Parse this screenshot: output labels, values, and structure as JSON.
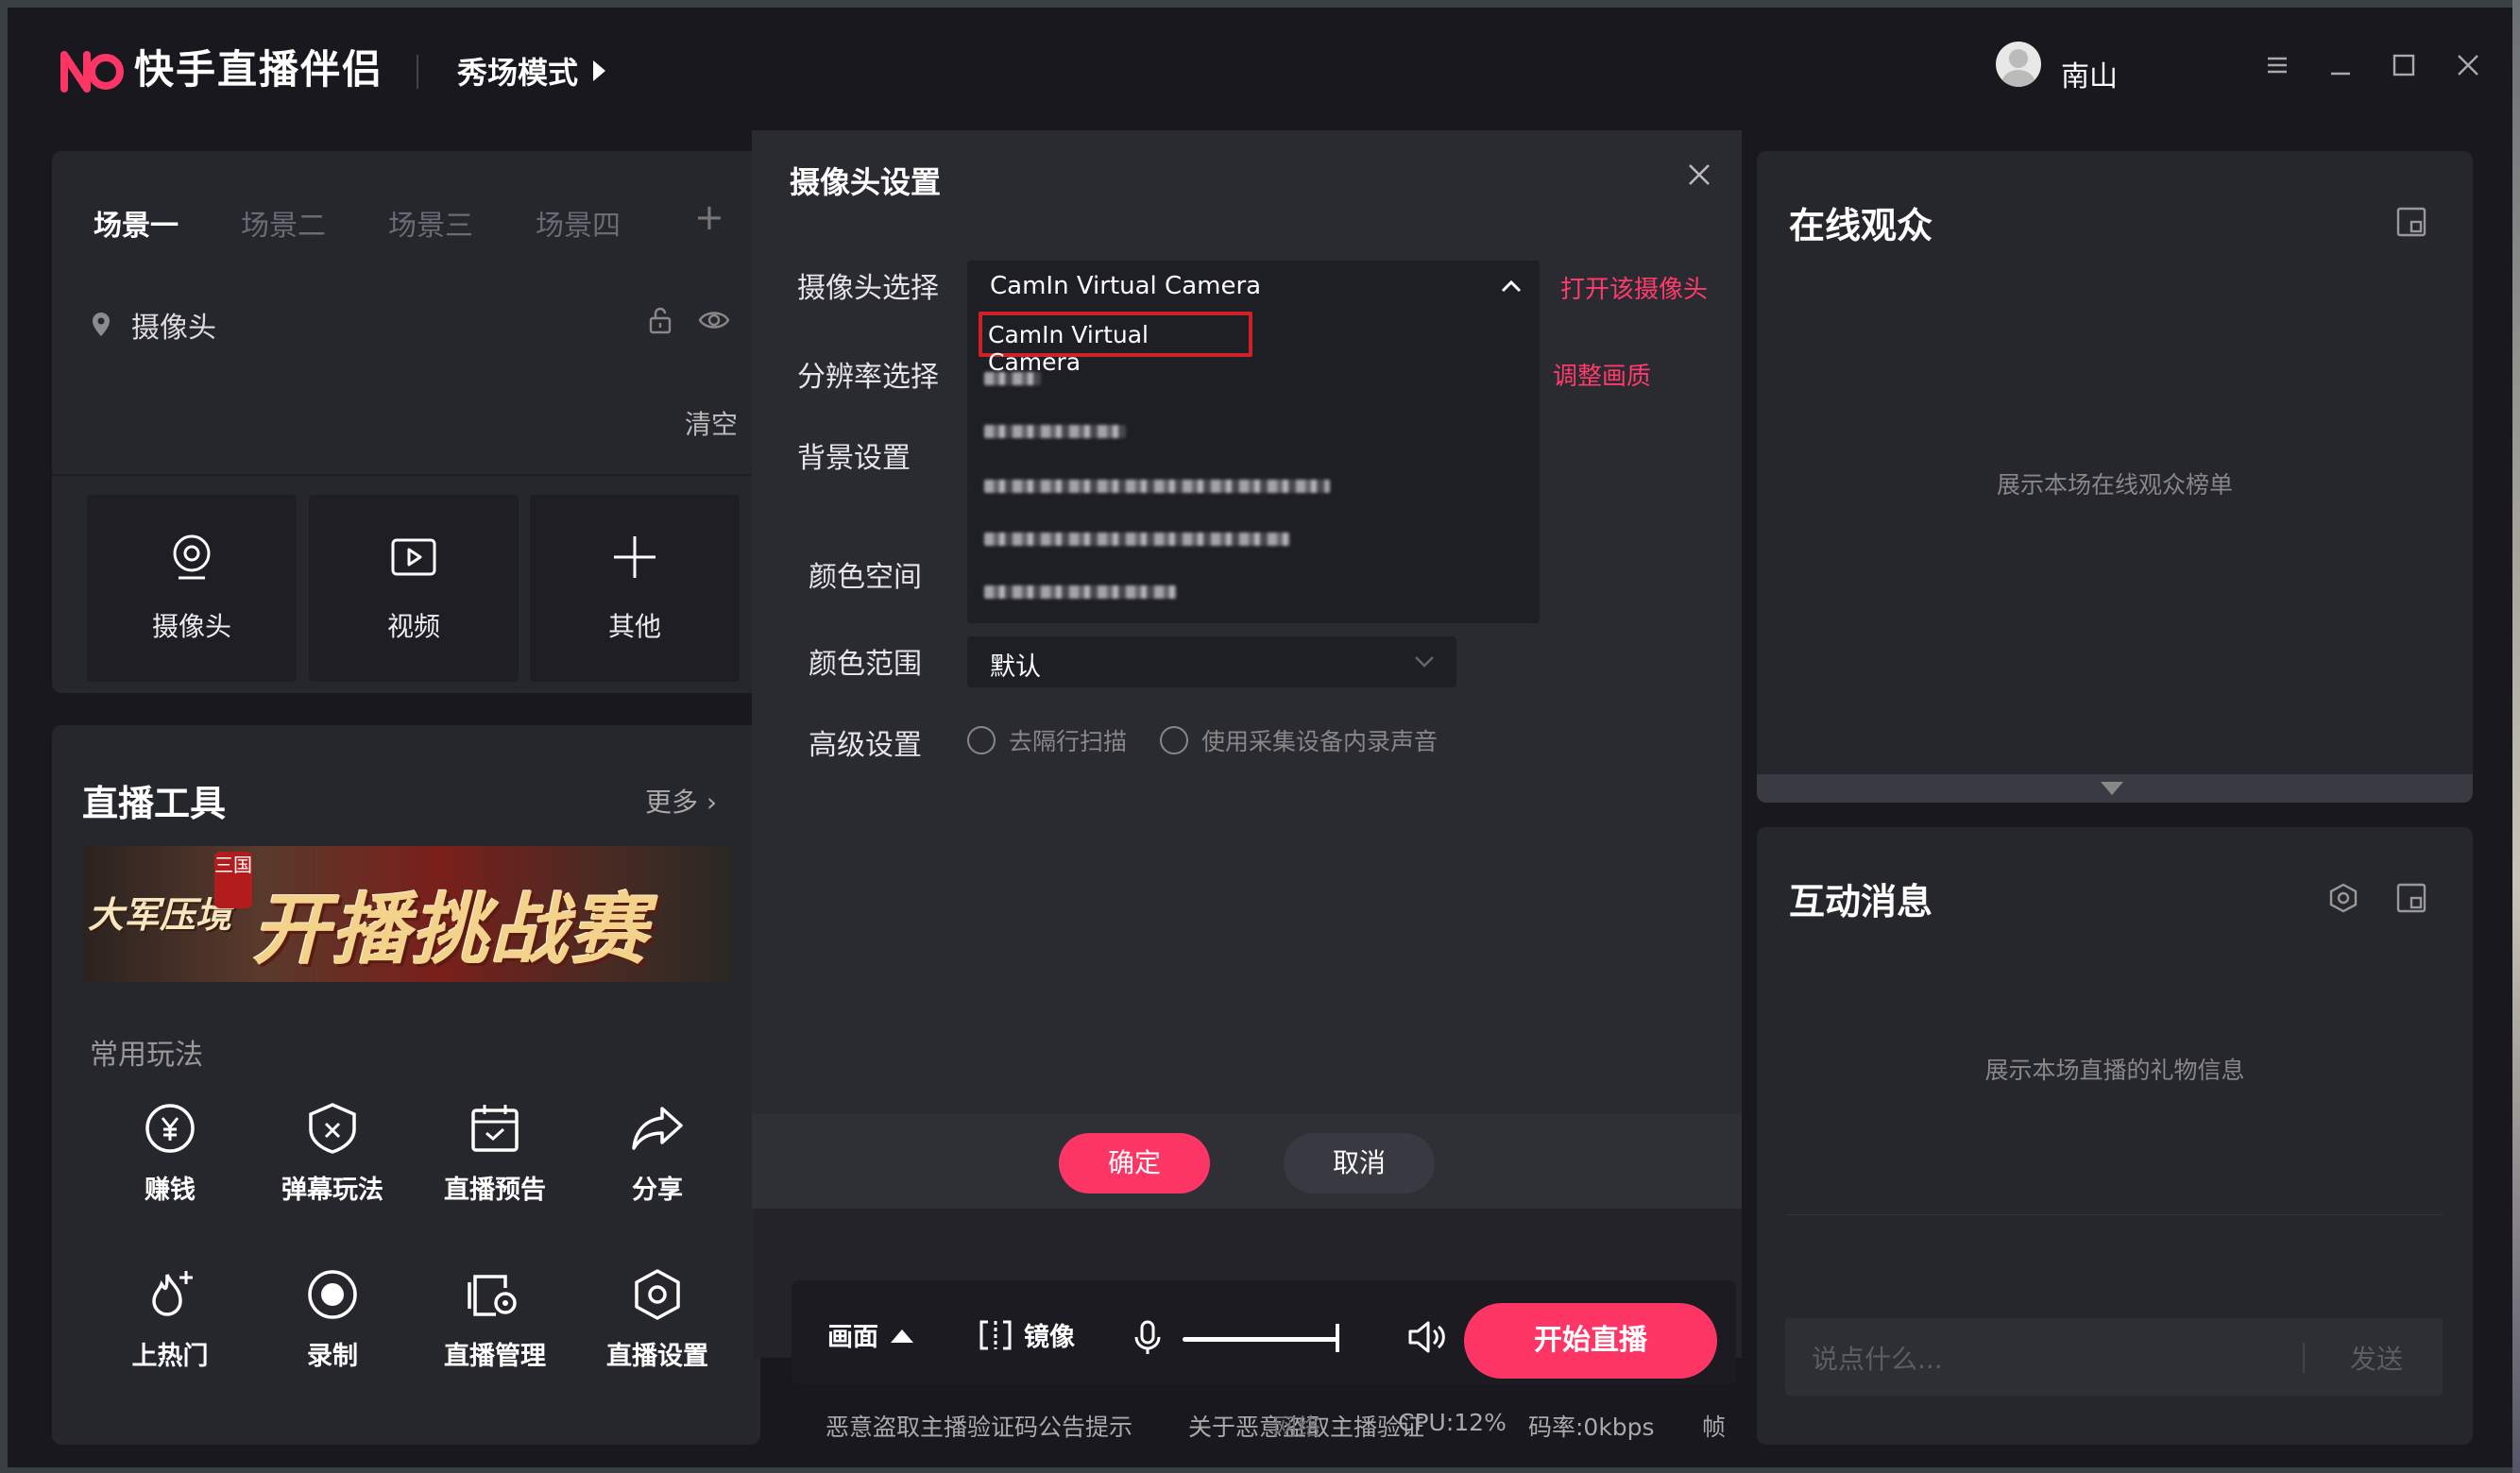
{
  "app": {
    "name": "快手直播伴侣",
    "mode": "秀场模式",
    "user": "南山",
    "brand_color": "#fe3666"
  },
  "scenes": {
    "tabs": [
      "场景一",
      "场景二",
      "场景三",
      "场景四"
    ],
    "active_index": 0,
    "add_label": "+",
    "source_item": "摄像头",
    "clear_label": "清空",
    "add_sources": [
      {
        "label": "摄像头",
        "icon": "webcam-icon"
      },
      {
        "label": "视频",
        "icon": "video-icon"
      },
      {
        "label": "其他",
        "icon": "plus-icon"
      }
    ]
  },
  "tools": {
    "title": "直播工具",
    "more_label": "更多",
    "banner": {
      "prefix": "大军压境",
      "seal": "三国",
      "main": "开播挑战赛"
    },
    "common_title": "常用玩法",
    "items": [
      {
        "label": "赚钱",
        "icon": "yen-coin-icon"
      },
      {
        "label": "弹幕玩法",
        "icon": "shield-game-icon"
      },
      {
        "label": "直播预告",
        "icon": "calendar-icon"
      },
      {
        "label": "分享",
        "icon": "share-arrow-icon"
      },
      {
        "label": "上热门",
        "icon": "flame-plus-icon"
      },
      {
        "label": "录制",
        "icon": "record-icon"
      },
      {
        "label": "直播管理",
        "icon": "manage-icon"
      },
      {
        "label": "直播设置",
        "icon": "settings-hex-icon"
      }
    ]
  },
  "dialog": {
    "title": "摄像头设置",
    "labels": {
      "camera": "摄像头选择",
      "resolution": "分辨率选择",
      "background": "背景设置",
      "color_space": "颜色空间",
      "color_range": "颜色范围",
      "advanced": "高级设置"
    },
    "camera_value": "CamIn Virtual Camera",
    "camera_options": [
      "CamIn Virtual Camera"
    ],
    "open_camera_link": "打开该摄像头",
    "adjust_quality_link": "调整画质",
    "color_range_value": "默认",
    "options": [
      "去隔行扫描",
      "使用采集设备内录声音"
    ],
    "ok_label": "确定",
    "cancel_label": "取消"
  },
  "bottom": {
    "canvas_label": "画面",
    "mirror_label": "镜像",
    "volume": 1.0,
    "start_label": "开始直播",
    "notices": [
      "恶意盗取主播验证码公告提示",
      "关于恶意盗取主播验证"
    ],
    "overlap_text": "网络",
    "cpu": "CPU:12%",
    "bitrate": "码率:0kbps",
    "fps_label": "帧"
  },
  "audience": {
    "title": "在线观众",
    "placeholder": "展示本场在线观众榜单"
  },
  "messages": {
    "title": "互动消息",
    "placeholder": "展示本场直播的礼物信息",
    "input_placeholder": "说点什么...",
    "send_label": "发送"
  }
}
